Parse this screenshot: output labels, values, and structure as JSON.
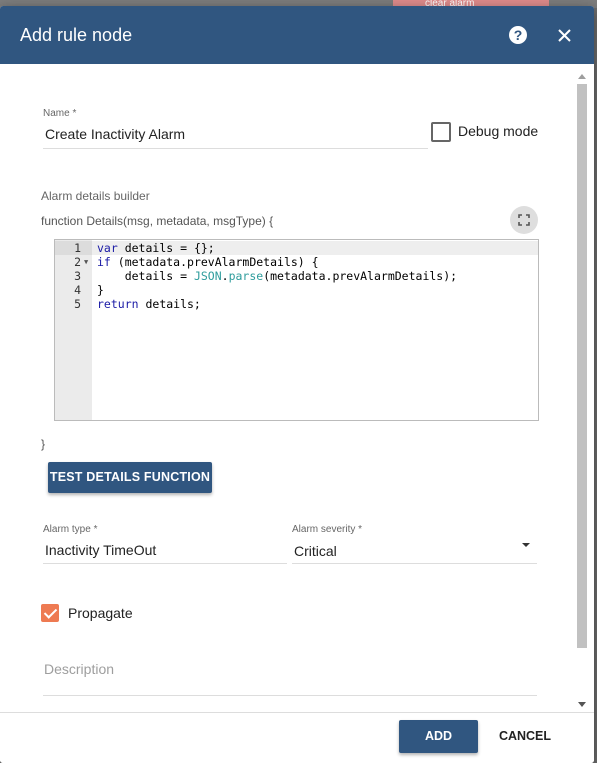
{
  "background": {
    "node_label": "clear alarm"
  },
  "dialog": {
    "title": "Add rule node",
    "help_icon": "help-circle-icon",
    "close_icon": "close-icon"
  },
  "form": {
    "name": {
      "label": "Name *",
      "value": "Create Inactivity Alarm"
    },
    "debug_mode": {
      "label": "Debug mode",
      "checked": false
    },
    "details_builder": {
      "label": "Alarm details builder",
      "signature": "function Details(msg, metadata, msgType) {",
      "closing": "}",
      "expand_icon": "fullscreen-icon",
      "code_lines": [
        {
          "n": "1",
          "text": "var details = {};"
        },
        {
          "n": "2",
          "text": "if (metadata.prevAlarmDetails) {"
        },
        {
          "n": "3",
          "text": "    details = JSON.parse(metadata.prevAlarmDetails);"
        },
        {
          "n": "4",
          "text": "}"
        },
        {
          "n": "5",
          "text": "return details;"
        }
      ]
    },
    "test_button": "TEST DETAILS FUNCTION",
    "alarm_type": {
      "label": "Alarm type *",
      "value": "Inactivity TimeOut"
    },
    "alarm_severity": {
      "label": "Alarm severity *",
      "value": "Critical"
    },
    "propagate": {
      "label": "Propagate",
      "checked": true
    },
    "description": {
      "placeholder": "Description"
    }
  },
  "footer": {
    "add_label": "ADD",
    "cancel_label": "CANCEL"
  },
  "colors": {
    "primary": "#305680",
    "accent": "#ee7a52"
  }
}
